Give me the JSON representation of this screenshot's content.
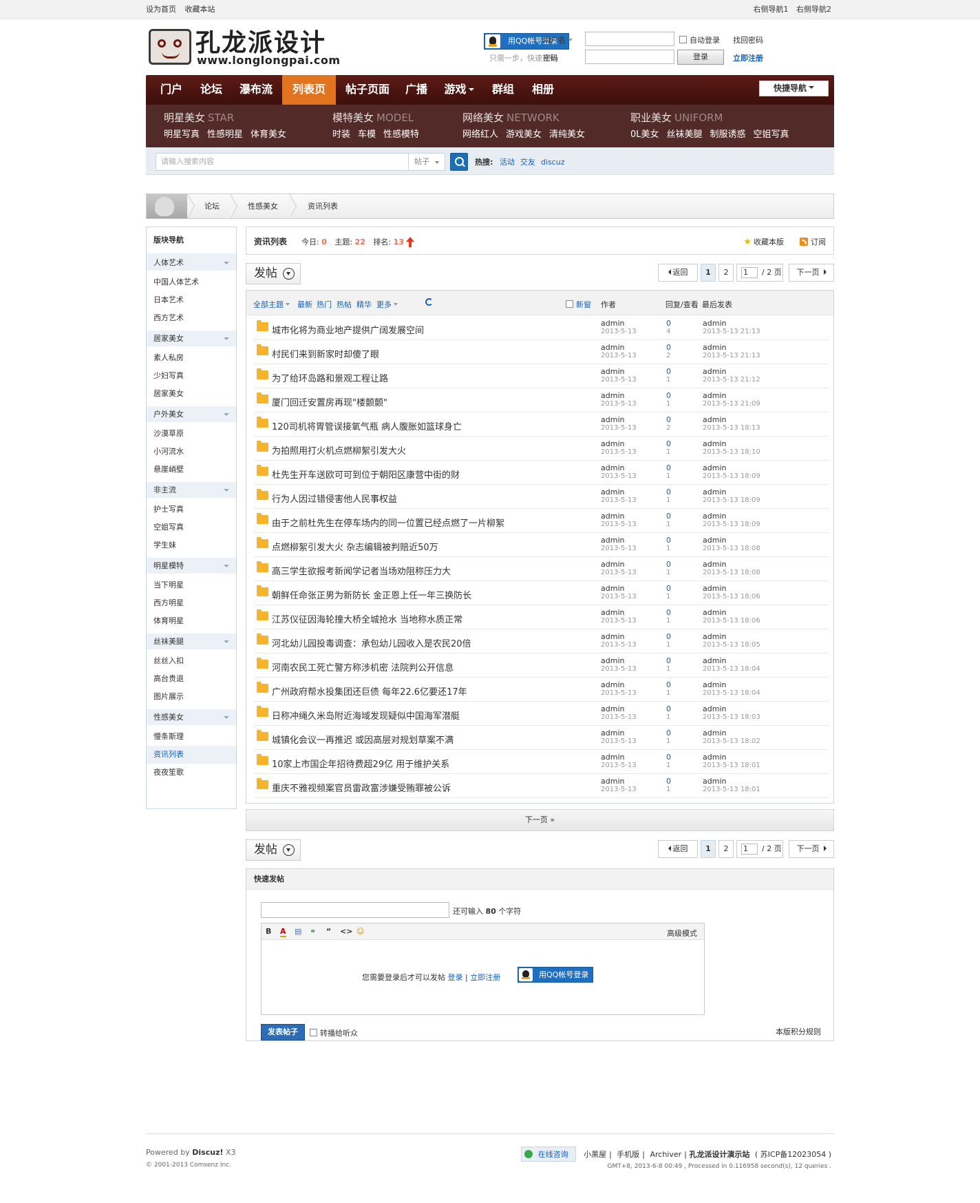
{
  "topbar": {
    "left": [
      "设为首页",
      "收藏本站"
    ],
    "right": [
      "右侧导航1",
      "右侧导航2"
    ]
  },
  "logo": {
    "cn": "孔龙派设计",
    "en": "www.longlongpai.com"
  },
  "login": {
    "qq_label": "用QQ帐号登录",
    "hint": "只需一步，快速开始",
    "username_label": "用户名",
    "password_label": "密码",
    "auto_login": "自动登录",
    "forgot": "找回密码",
    "login_button": "登录",
    "register": "立即注册"
  },
  "nav": {
    "items": [
      "门户",
      "论坛",
      "瀑布流",
      "列表页",
      "帖子页面",
      "广播",
      "游戏",
      "群组",
      "相册"
    ],
    "active": "列表页",
    "quick": "快捷导航"
  },
  "subnav": [
    {
      "title": "明星美女",
      "en": "STAR",
      "links": [
        "明星写真",
        "性感明星",
        "体育美女"
      ]
    },
    {
      "title": "模特美女",
      "en": "MODEL",
      "links": [
        "时装",
        "车模",
        "性感模特"
      ]
    },
    {
      "title": "网络美女",
      "en": "NETWORK",
      "links": [
        "网络红人",
        "游戏美女",
        "清纯美女"
      ]
    },
    {
      "title": "职业美女",
      "en": "UNIFORM",
      "links": [
        "0L美女",
        "丝袜美腿",
        "制服诱惑",
        "空姐写真"
      ]
    }
  ],
  "search": {
    "placeholder": "请输入搜索内容",
    "type": "帖子",
    "hot_label": "热搜:",
    "hot": [
      "活动",
      "交友",
      "discuz"
    ]
  },
  "breadcrumb": [
    "论坛",
    "性感美女",
    "资讯列表"
  ],
  "sidebar": {
    "title": "版块导航",
    "groups": [
      {
        "name": "人体艺术",
        "items": [
          "中国人体艺术",
          "日本艺术",
          "西方艺术"
        ]
      },
      {
        "name": "居家美女",
        "items": [
          "素人私房",
          "少妇写真",
          "居家美女"
        ]
      },
      {
        "name": "户外美女",
        "items": [
          "沙漠草原",
          "小河流水",
          "悬崖峭壁"
        ]
      },
      {
        "name": "非主流",
        "items": [
          "护士写真",
          "空姐写真",
          "学生妹"
        ]
      },
      {
        "name": "明星模特",
        "items": [
          "当下明星",
          "西方明星",
          "体育明星"
        ]
      },
      {
        "name": "丝袜美腿",
        "items": [
          "丝丝入扣",
          "高台贵退",
          "图片展示"
        ]
      },
      {
        "name": "性感美女",
        "items": [
          "慢条斯理",
          "资讯列表",
          "夜夜笙歌"
        ]
      }
    ],
    "current": "资讯列表"
  },
  "forum": {
    "title": "资讯列表",
    "today_label": "今日:",
    "today": "0",
    "topics_label": "主题:",
    "topics": "22",
    "rank_label": "排名:",
    "rank": "13",
    "fav": "收藏本版",
    "rss": "订阅"
  },
  "pager": {
    "post": "发帖",
    "back": "返回",
    "pages": [
      "1",
      "2"
    ],
    "current_input": "1",
    "total": "/ 2 页",
    "next": "下一页"
  },
  "thread_header": {
    "filters": [
      "全部主题",
      "最新",
      "热门",
      "热帖",
      "精华",
      "更多"
    ],
    "new_window": "新窗",
    "author": "作者",
    "reply_view": "回复/查看",
    "last_post": "最后发表"
  },
  "threads": [
    {
      "title": "城市化将为商业地产提供广阔发展空间",
      "author": "admin",
      "date": "2013-5-13",
      "replies": "0",
      "views": "4",
      "last_user": "admin",
      "last_time": "2013-5-13 21:13"
    },
    {
      "title": "村民们来到新家时却傻了眼",
      "author": "admin",
      "date": "2013-5-13",
      "replies": "0",
      "views": "2",
      "last_user": "admin",
      "last_time": "2013-5-13 21:13"
    },
    {
      "title": "为了给环岛路和景观工程让路",
      "author": "admin",
      "date": "2013-5-13",
      "replies": "0",
      "views": "1",
      "last_user": "admin",
      "last_time": "2013-5-13 21:12"
    },
    {
      "title": "厦门回迁安置房再现\"楼颤颤\"",
      "author": "admin",
      "date": "2013-5-13",
      "replies": "0",
      "views": "1",
      "last_user": "admin",
      "last_time": "2013-5-13 21:09"
    },
    {
      "title": "120司机将胃管误接氧气瓶 病人腹胀如篮球身亡",
      "author": "admin",
      "date": "2013-5-13",
      "replies": "0",
      "views": "2",
      "last_user": "admin",
      "last_time": "2013-5-13 18:13"
    },
    {
      "title": "为拍照用打火机点燃柳絮引发大火",
      "author": "admin",
      "date": "2013-5-13",
      "replies": "0",
      "views": "1",
      "last_user": "admin",
      "last_time": "2013-5-13 18:10"
    },
    {
      "title": "杜先生开车送欧可可到位于朝阳区康营中街的财",
      "author": "admin",
      "date": "2013-5-13",
      "replies": "0",
      "views": "1",
      "last_user": "admin",
      "last_time": "2013-5-13 18:09"
    },
    {
      "title": "行为人因过错侵害他人民事权益",
      "author": "admin",
      "date": "2013-5-13",
      "replies": "0",
      "views": "1",
      "last_user": "admin",
      "last_time": "2013-5-13 18:09"
    },
    {
      "title": "由于之前杜先生在停车场内的同一位置已经点燃了一片柳絮",
      "author": "admin",
      "date": "2013-5-13",
      "replies": "0",
      "views": "1",
      "last_user": "admin",
      "last_time": "2013-5-13 18:09"
    },
    {
      "title": "点燃柳絮引发大火 杂志编辑被判赔近50万",
      "author": "admin",
      "date": "2013-5-13",
      "replies": "0",
      "views": "1",
      "last_user": "admin",
      "last_time": "2013-5-13 18:08"
    },
    {
      "title": "高三学生欲报考新闻学记者当场劝阻称压力大",
      "author": "admin",
      "date": "2013-5-13",
      "replies": "0",
      "views": "1",
      "last_user": "admin",
      "last_time": "2013-5-13 18:08"
    },
    {
      "title": "朝鲜任命张正男为新防长 金正恩上任一年三换防长",
      "author": "admin",
      "date": "2013-5-13",
      "replies": "0",
      "views": "1",
      "last_user": "admin",
      "last_time": "2013-5-13 18:06"
    },
    {
      "title": "江苏仪征因海轮撞大桥全城抢水 当地称水质正常",
      "author": "admin",
      "date": "2013-5-13",
      "replies": "0",
      "views": "1",
      "last_user": "admin",
      "last_time": "2013-5-13 18:06"
    },
    {
      "title": "河北幼儿园投毒调查：承包幼儿园收入是农民20倍",
      "author": "admin",
      "date": "2013-5-13",
      "replies": "0",
      "views": "1",
      "last_user": "admin",
      "last_time": "2013-5-13 18:05"
    },
    {
      "title": "河南农民工死亡警方称涉机密 法院判公开信息",
      "author": "admin",
      "date": "2013-5-13",
      "replies": "0",
      "views": "1",
      "last_user": "admin",
      "last_time": "2013-5-13 18:04"
    },
    {
      "title": "广州政府帮水投集团还巨债 每年22.6亿要还17年",
      "author": "admin",
      "date": "2013-5-13",
      "replies": "0",
      "views": "1",
      "last_user": "admin",
      "last_time": "2013-5-13 18:04"
    },
    {
      "title": "日称冲绳久米岛附近海域发现疑似中国海军潜艇",
      "author": "admin",
      "date": "2013-5-13",
      "replies": "0",
      "views": "1",
      "last_user": "admin",
      "last_time": "2013-5-13 18:03"
    },
    {
      "title": "城镇化会议一再推迟 或因高层对规划草案不满",
      "author": "admin",
      "date": "2013-5-13",
      "replies": "0",
      "views": "1",
      "last_user": "admin",
      "last_time": "2013-5-13 18:02"
    },
    {
      "title": "10家上市国企年招待费超29亿 用于维护关系",
      "author": "admin",
      "date": "2013-5-13",
      "replies": "0",
      "views": "1",
      "last_user": "admin",
      "last_time": "2013-5-13 18:01"
    },
    {
      "title": "重庆不雅视频案官员雷政富涉嫌受贿罪被公诉",
      "author": "admin",
      "date": "2013-5-13",
      "replies": "0",
      "views": "1",
      "last_user": "admin",
      "last_time": "2013-5-13 18:01"
    }
  ],
  "next_page": "下一页 »",
  "quickpost": {
    "title": "快速发帖",
    "remain_prefix": "还可输入",
    "remain_count": "80",
    "remain_suffix": "个字符",
    "toolbar": [
      "B",
      "A",
      "▤",
      "⚭",
      "“",
      "<>",
      "☺"
    ],
    "advanced": "高级模式",
    "need_login": "您需要登录后才可以发帖",
    "login": "登录",
    "register": "立即注册",
    "qq_label": "用QQ帐号登录",
    "submit": "发表帖子",
    "broadcast": "转播给听众",
    "rules": "本版积分规则"
  },
  "footer": {
    "powered_prefix": "Powered by",
    "powered_name": "Discuz!",
    "powered_ver": "X3",
    "copyright": "© 2001-2013 Comsenz Inc.",
    "online": "在线咨询",
    "links": [
      "小黑屋",
      "手机版",
      "Archiver"
    ],
    "site": "孔龙派设计演示站",
    "icp": "( 苏ICP备12023054 )",
    "meta": "GMT+8, 2013-6-8 00:49 , Processed in 0.116958 second(s), 12 queries ."
  }
}
